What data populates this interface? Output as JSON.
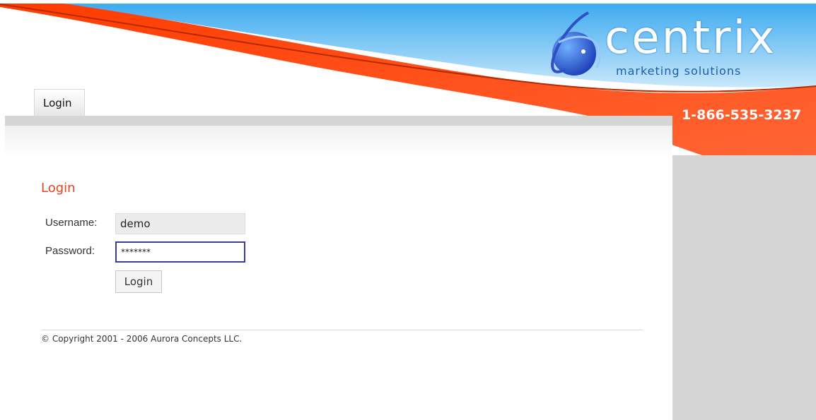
{
  "brand": {
    "name": "centrix",
    "tagline": "marketing solutions",
    "phone": "1-866-535-3237"
  },
  "nav": {
    "tabs": [
      {
        "label": "Login",
        "active": true
      }
    ]
  },
  "login": {
    "title": "Login",
    "username_label": "Username:",
    "username_value": "demo",
    "password_label": "Password:",
    "password_value": "*******",
    "submit_label": "Login"
  },
  "footer": {
    "copyright": "© Copyright 2001 - 2006 Aurora Concepts LLC."
  },
  "colors": {
    "accent": "#e8431b",
    "sky": "#5fb6ea",
    "orange": "#ff4a12",
    "panel_gray": "#d6d6d6",
    "focus_border": "#3a3c9a"
  },
  "icons": [
    "globe-logo-icon"
  ]
}
